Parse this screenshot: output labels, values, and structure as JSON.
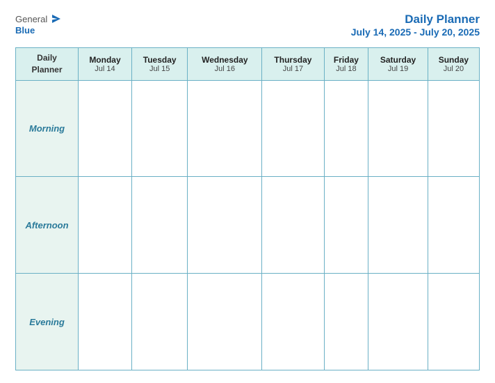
{
  "header": {
    "logo": {
      "general": "General",
      "blue": "Blue",
      "icon_alt": "blue-arrow-icon"
    },
    "title": "Daily Planner",
    "date_range": "July 14, 2025 - July 20, 2025"
  },
  "table": {
    "header_label_line1": "Daily",
    "header_label_line2": "Planner",
    "days": [
      {
        "name": "Monday",
        "date": "Jul 14"
      },
      {
        "name": "Tuesday",
        "date": "Jul 15"
      },
      {
        "name": "Wednesday",
        "date": "Jul 16"
      },
      {
        "name": "Thursday",
        "date": "Jul 17"
      },
      {
        "name": "Friday",
        "date": "Jul 18"
      },
      {
        "name": "Saturday",
        "date": "Jul 19"
      },
      {
        "name": "Sunday",
        "date": "Jul 20"
      }
    ],
    "rows": [
      {
        "label": "Morning"
      },
      {
        "label": "Afternoon"
      },
      {
        "label": "Evening"
      }
    ]
  }
}
